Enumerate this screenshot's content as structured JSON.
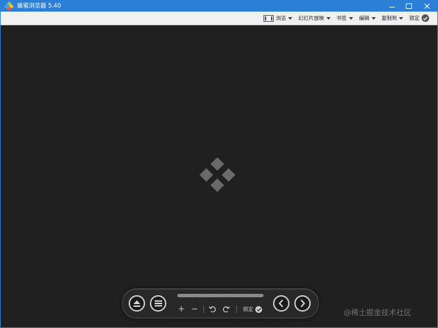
{
  "window": {
    "title": "蜂蜜浏览器 5.40"
  },
  "menubar": {
    "items": [
      {
        "label": "浏览",
        "icon": "browse-icon"
      },
      {
        "label": "幻灯片放映"
      },
      {
        "label": "书签"
      },
      {
        "label": "编辑"
      },
      {
        "label": "复制到"
      },
      {
        "label": "锁定",
        "icon": "check-circle-icon"
      }
    ]
  },
  "controlbar": {
    "zoom_in": "+",
    "zoom_out": "−",
    "lock_label": "锁定",
    "progress": 0.0
  },
  "watermark": "@稀土掘金技术社区",
  "colors": {
    "titlebar": "#2b7fd6",
    "canvas": "#202020",
    "logo": "#6a6a6a"
  }
}
